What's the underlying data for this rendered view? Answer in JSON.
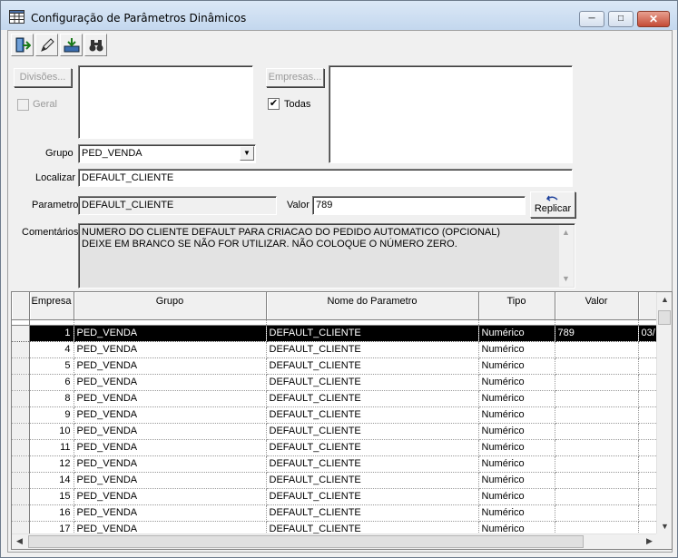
{
  "window": {
    "title": "Configuração de Parâmetros Dinâmicos",
    "minimize": "─",
    "maximize": "□",
    "close": "✕"
  },
  "toolbar": {
    "icons": [
      "exit-door-icon",
      "edit-pencil-icon",
      "save-tray-icon",
      "binoculars-search-icon"
    ]
  },
  "form": {
    "divisoes_button": "Divisões...",
    "geral_label": "Geral",
    "geral_checked": false,
    "empresas_button": "Empresas...",
    "todas_label": "Todas",
    "todas_checked": true,
    "check_mark": "✔",
    "grupo_label": "Grupo",
    "grupo_value": "PED_VENDA",
    "combo_arrow": "▼",
    "localizar_label": "Localizar",
    "localizar_value": "DEFAULT_CLIENTE",
    "parametro_label": "Parametro",
    "parametro_value": "DEFAULT_CLIENTE",
    "valor_label": "Valor",
    "valor_value": "789",
    "replicar_button": "Replicar",
    "comentarios_label": "Comentários",
    "comentarios_value": "NUMERO DO CLIENTE DEFAULT PARA CRIACAO DO PEDIDO AUTOMATICO (OPCIONAL)\nDEIXE EM BRANCO SE NÃO FOR UTILIZAR. NÃO COLOQUE O NÚMERO ZERO."
  },
  "grid": {
    "columns": [
      "Empresa",
      "Grupo",
      "Nome do Parametro",
      "Tipo",
      "Valor",
      ""
    ],
    "rows": [
      {
        "empresa": "1",
        "grupo": "PED_VENDA",
        "nome": "DEFAULT_CLIENTE",
        "tipo": "Numérico",
        "valor": "789",
        "extra": "03/",
        "selected": true
      },
      {
        "empresa": "4",
        "grupo": "PED_VENDA",
        "nome": "DEFAULT_CLIENTE",
        "tipo": "Numérico",
        "valor": "",
        "extra": ""
      },
      {
        "empresa": "5",
        "grupo": "PED_VENDA",
        "nome": "DEFAULT_CLIENTE",
        "tipo": "Numérico",
        "valor": "",
        "extra": ""
      },
      {
        "empresa": "6",
        "grupo": "PED_VENDA",
        "nome": "DEFAULT_CLIENTE",
        "tipo": "Numérico",
        "valor": "",
        "extra": ""
      },
      {
        "empresa": "8",
        "grupo": "PED_VENDA",
        "nome": "DEFAULT_CLIENTE",
        "tipo": "Numérico",
        "valor": "",
        "extra": ""
      },
      {
        "empresa": "9",
        "grupo": "PED_VENDA",
        "nome": "DEFAULT_CLIENTE",
        "tipo": "Numérico",
        "valor": "",
        "extra": ""
      },
      {
        "empresa": "10",
        "grupo": "PED_VENDA",
        "nome": "DEFAULT_CLIENTE",
        "tipo": "Numérico",
        "valor": "",
        "extra": ""
      },
      {
        "empresa": "11",
        "grupo": "PED_VENDA",
        "nome": "DEFAULT_CLIENTE",
        "tipo": "Numérico",
        "valor": "",
        "extra": ""
      },
      {
        "empresa": "12",
        "grupo": "PED_VENDA",
        "nome": "DEFAULT_CLIENTE",
        "tipo": "Numérico",
        "valor": "",
        "extra": ""
      },
      {
        "empresa": "14",
        "grupo": "PED_VENDA",
        "nome": "DEFAULT_CLIENTE",
        "tipo": "Numérico",
        "valor": "",
        "extra": ""
      },
      {
        "empresa": "15",
        "grupo": "PED_VENDA",
        "nome": "DEFAULT_CLIENTE",
        "tipo": "Numérico",
        "valor": "",
        "extra": ""
      },
      {
        "empresa": "16",
        "grupo": "PED_VENDA",
        "nome": "DEFAULT_CLIENTE",
        "tipo": "Numérico",
        "valor": "",
        "extra": ""
      },
      {
        "empresa": "17",
        "grupo": "PED_VENDA",
        "nome": "DEFAULT_CLIENTE",
        "tipo": "Numérico",
        "valor": "",
        "extra": ""
      }
    ]
  },
  "scrollbars": {
    "up": "▲",
    "down": "▼",
    "left": "◀",
    "right": "▶"
  }
}
